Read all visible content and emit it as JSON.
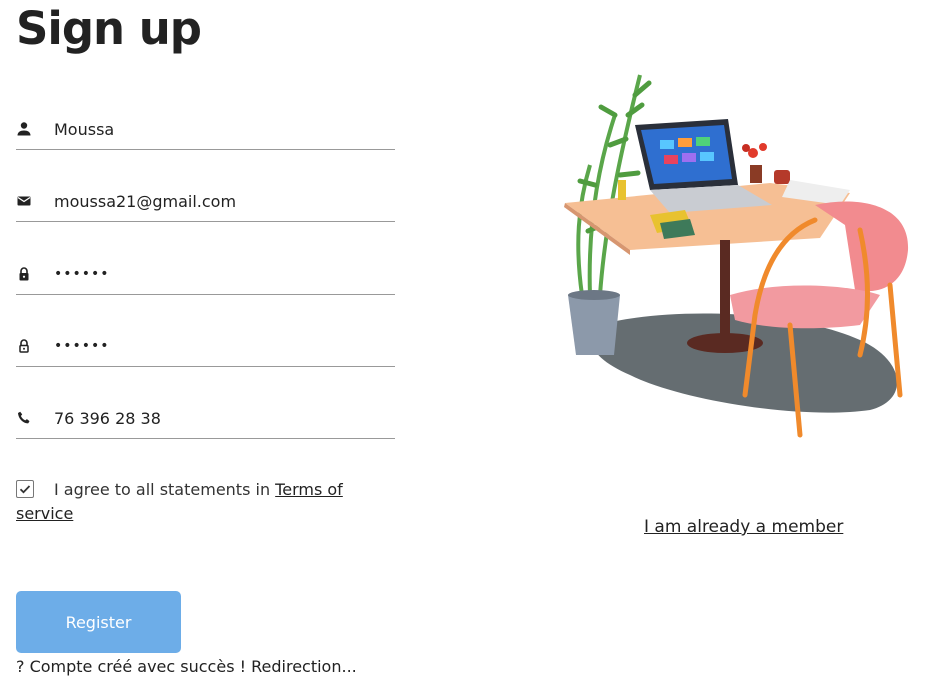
{
  "page": {
    "title": "Sign up"
  },
  "form": {
    "name_value": "Moussa",
    "email_value": "moussa21@gmail.com",
    "password_value": "••••••",
    "confirm_password_value": "••••••",
    "phone_value": "76 396 28 38"
  },
  "agreement": {
    "checked": true,
    "text": "I agree to all statements in ",
    "link": "Terms of service"
  },
  "actions": {
    "register_label": "Register",
    "status_message": "? Compte créé avec succès ! Redirection...",
    "member_link": "I am already a member"
  },
  "icons": {
    "name": "person-icon",
    "email": "mail-icon",
    "password": "lock-icon",
    "confirm_password": "lock-outline-icon",
    "phone": "phone-icon",
    "checkbox": "check-icon"
  },
  "colors": {
    "register_button": "#6dade8",
    "underline": "#999999",
    "text": "#222222"
  }
}
